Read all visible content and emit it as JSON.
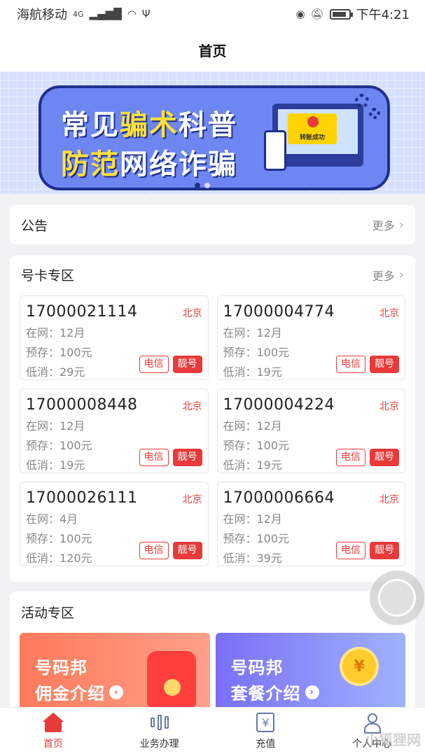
{
  "status_bar": {
    "carrier": "海航移动",
    "network": "4G",
    "time": "下午4:21"
  },
  "header": {
    "title": "首页"
  },
  "banner": {
    "line1_a": "常见",
    "line1_b": "骗术",
    "line1_c": "科普",
    "line2_a": "防范",
    "line2_b": "网络诈骗",
    "stamp": "转账成功"
  },
  "notice": {
    "title": "公告",
    "more": "更多"
  },
  "numbers_section": {
    "title": "号卡专区",
    "more": "更多",
    "cards": [
      {
        "number": "17000021114",
        "city": "北京",
        "online": "在网：12月",
        "prestore": "预存：100元",
        "min": "低消：29元",
        "tag1": "电信",
        "tag2": "靓号"
      },
      {
        "number": "17000004774",
        "city": "北京",
        "online": "在网：12月",
        "prestore": "预存：100元",
        "min": "低消：19元",
        "tag1": "电信",
        "tag2": "靓号"
      },
      {
        "number": "17000008448",
        "city": "北京",
        "online": "在网：12月",
        "prestore": "预存：100元",
        "min": "低消：19元",
        "tag1": "电信",
        "tag2": "靓号"
      },
      {
        "number": "17000004224",
        "city": "北京",
        "online": "在网：12月",
        "prestore": "预存：100元",
        "min": "低消：19元",
        "tag1": "电信",
        "tag2": "靓号"
      },
      {
        "number": "17000026111",
        "city": "北京",
        "online": "在网：4月",
        "prestore": "预存：100元",
        "min": "低消：120元",
        "tag1": "电信",
        "tag2": "靓号"
      },
      {
        "number": "17000006664",
        "city": "北京",
        "online": "在网：12月",
        "prestore": "预存：100元",
        "min": "低消：39元",
        "tag1": "电信",
        "tag2": "靓号"
      }
    ]
  },
  "activity": {
    "title": "活动专区",
    "items": [
      {
        "title": "号码邦",
        "subtitle": "佣金介绍"
      },
      {
        "title": "号码邦",
        "subtitle": "套餐介绍"
      }
    ]
  },
  "tab_bar": {
    "items": [
      {
        "label": "首页"
      },
      {
        "label": "业务办理"
      },
      {
        "label": "充值"
      },
      {
        "label": "个人中心"
      }
    ]
  },
  "watermark": "小狐狸网"
}
